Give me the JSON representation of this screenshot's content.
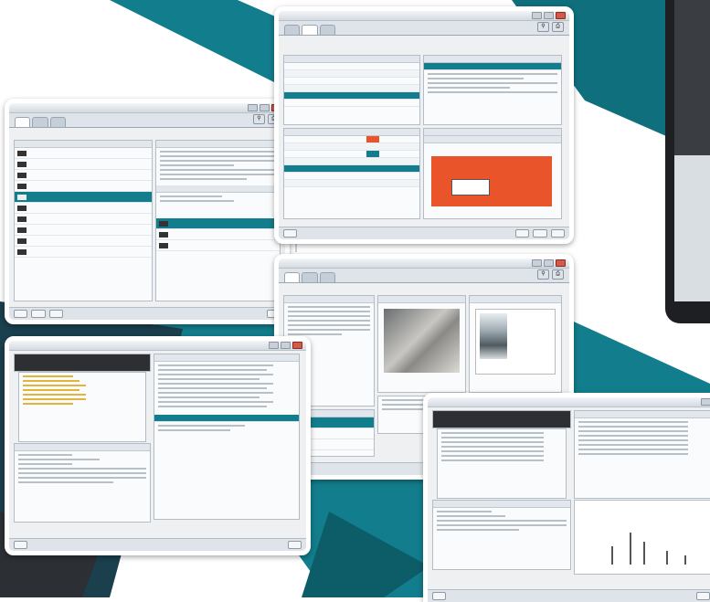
{
  "colors": {
    "teal": "#127d8c",
    "orange": "#e9542a",
    "dark": "#2d2f33"
  },
  "windows": [
    {
      "title": "",
      "tabs": [
        "",
        "",
        ""
      ],
      "active_tab": 0
    },
    {
      "title": "",
      "tabs": [
        "",
        "",
        ""
      ],
      "active_tab": 1
    },
    {
      "title": "",
      "tabs": [
        "",
        "",
        ""
      ],
      "active_tab": 0
    },
    {
      "title": "",
      "tabs": [],
      "active_tab": null
    },
    {
      "title": "",
      "tabs": [],
      "active_tab": null
    }
  ],
  "icons": [
    "search-icon",
    "print-icon",
    "close-icon",
    "folder-icon",
    "chevron-down-icon"
  ]
}
